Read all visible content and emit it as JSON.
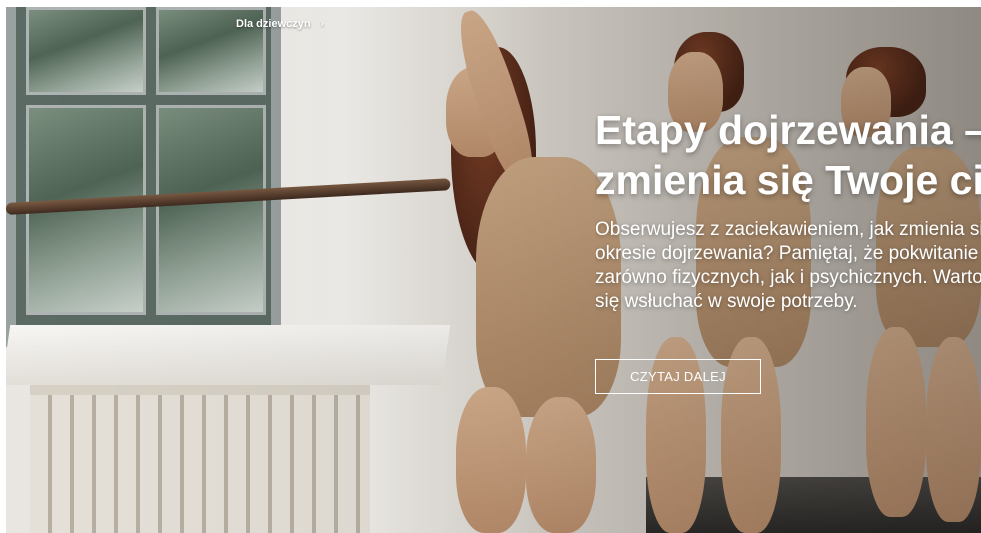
{
  "breadcrumb": {
    "items": [
      "Dla dziewczyn"
    ],
    "separator": "›"
  },
  "hero": {
    "title_lines": [
      "Etapy dojrzewania –",
      "zmienia się Twoje ciało"
    ],
    "description_lines": [
      "Obserwujesz z zaciekawieniem, jak zmienia się Twoje ciało w",
      "okresie dojrzewania? Pamiętaj, że pokwitanie to czas zmian",
      "zarówno fizycznych, jak i psychicznych. Warto",
      "się wsłuchać w swoje potrzeby."
    ],
    "cta_label": "CZYTAJ DALEJ"
  },
  "colors": {
    "text": "#ffffff",
    "button_border": "#ffffff"
  }
}
